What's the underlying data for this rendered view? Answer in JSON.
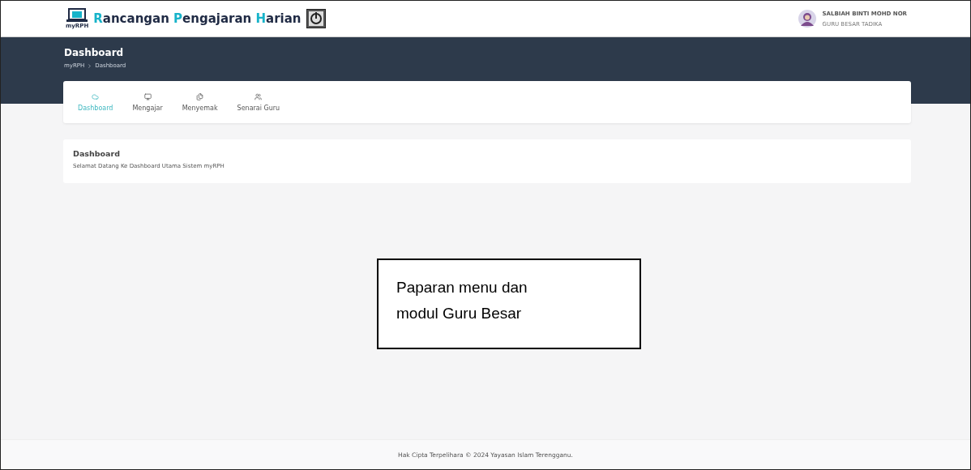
{
  "header": {
    "logo_label": "myRPH",
    "title_parts": [
      {
        "text": "R",
        "accent": true
      },
      {
        "text": "ancangan ",
        "accent": false
      },
      {
        "text": "P",
        "accent": true
      },
      {
        "text": "engajaran ",
        "accent": false
      },
      {
        "text": "H",
        "accent": true
      },
      {
        "text": "arian",
        "accent": false
      }
    ],
    "user": {
      "name": "SALBIAH BINTI MOHD NOR",
      "role": "GURU BESAR TADIKA"
    }
  },
  "page_header": {
    "title": "Dashboard",
    "breadcrumb": [
      "myRPH",
      "Dashboard"
    ]
  },
  "tabs": [
    {
      "label": "Dashboard",
      "selected": true
    },
    {
      "label": "Mengajar",
      "selected": false
    },
    {
      "label": "Menyemak",
      "selected": false
    },
    {
      "label": "Senarai Guru",
      "selected": false
    }
  ],
  "card": {
    "title": "Dashboard",
    "text": "Selamat Datang Ke Dashboard Utama Sistem myRPH"
  },
  "callout": {
    "lines": [
      "Paparan menu dan",
      "modul Guru Besar"
    ]
  },
  "footer": "Hak Cipta Terpelihara © 2024 Yayasan Islam Terengganu."
}
